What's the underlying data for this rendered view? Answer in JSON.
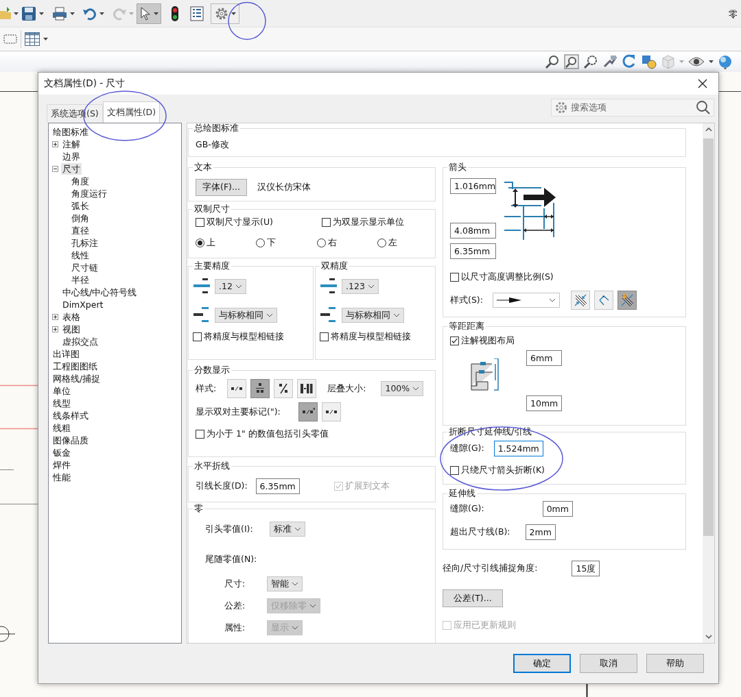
{
  "app": {
    "title_fragment": "零"
  },
  "dialog": {
    "title": "文档属性(D) - 尺寸"
  },
  "tabs": [
    {
      "label": "系统选项(S)",
      "selected": false
    },
    {
      "label": "文档属性(D)",
      "selected": true
    }
  ],
  "search": {
    "placeholder": "搜索选项"
  },
  "tree": [
    {
      "label": "绘图标准",
      "selected": false,
      "children": [
        {
          "label": "注解",
          "selected": false,
          "expanded": false
        },
        {
          "label": "边界",
          "selected": false
        },
        {
          "label": "尺寸",
          "selected": true,
          "expanded": true,
          "children": [
            {
              "label": "角度",
              "selected": false
            },
            {
              "label": "角度运行",
              "selected": false
            },
            {
              "label": "弧长",
              "selected": false
            },
            {
              "label": "倒角",
              "selected": false
            },
            {
              "label": "直径",
              "selected": false
            },
            {
              "label": "孔标注",
              "selected": false
            },
            {
              "label": "线性",
              "selected": false
            },
            {
              "label": "尺寸链",
              "selected": false
            },
            {
              "label": "半径",
              "selected": false
            }
          ]
        },
        {
          "label": "中心线/中心符号线",
          "selected": false
        },
        {
          "label": "DimXpert",
          "selected": false
        },
        {
          "label": "表格",
          "selected": false,
          "expanded": false
        },
        {
          "label": "视图",
          "selected": false,
          "expanded": false
        },
        {
          "label": "虚拟交点",
          "selected": false
        }
      ]
    },
    {
      "label": "出详图",
      "selected": false
    },
    {
      "label": "工程图图纸",
      "selected": false
    },
    {
      "label": "网格线/捕捉",
      "selected": false
    },
    {
      "label": "单位",
      "selected": false
    },
    {
      "label": "线型",
      "selected": false
    },
    {
      "label": "线条样式",
      "selected": false
    },
    {
      "label": "线粗",
      "selected": false
    },
    {
      "label": "图像品质",
      "selected": false
    },
    {
      "label": "钣金",
      "selected": false
    },
    {
      "label": "焊件",
      "selected": false
    },
    {
      "label": "性能",
      "selected": false
    }
  ],
  "general_standard": {
    "title": "总绘图标准",
    "value": "GB-修改"
  },
  "text_group": {
    "title": "文本",
    "button": "字体(F)...",
    "font": "汉仪长仿宋体"
  },
  "dual_dimensions": {
    "title": "双制尺寸",
    "checkboxes": [
      {
        "label": "双制尺寸显示(U)",
        "checked": false
      },
      {
        "label": "为双显示显示单位",
        "checked": false
      }
    ],
    "positions": [
      {
        "label": "上",
        "selected": true
      },
      {
        "label": "下",
        "selected": false
      },
      {
        "label": "右",
        "selected": false
      },
      {
        "label": "左",
        "selected": false
      }
    ]
  },
  "precision": [
    {
      "title": "主要精度",
      "value": ".12",
      "tolerance": "与标称相同",
      "link": {
        "label": "将精度与模型相链接",
        "checked": false
      }
    },
    {
      "title": "双精度",
      "value": ".123",
      "tolerance": "与标称相同",
      "link": {
        "label": "将精度与模型相链接",
        "checked": false
      }
    }
  ],
  "fraction": {
    "title": "分数显示",
    "style_label": "样式:",
    "styles": [
      {
        "kind": "slash",
        "selected": false
      },
      {
        "kind": "stacked",
        "selected": true
      },
      {
        "kind": "diagonal",
        "selected": false
      },
      {
        "kind": "dash",
        "selected": false
      }
    ],
    "stack_label": "层叠大小:",
    "stack_size": "100%",
    "dual_mark_label": "显示双对主要标记(\"):",
    "dual_marks": [
      {
        "kind": "inch",
        "selected": true
      },
      {
        "kind": "slash",
        "selected": false
      }
    ],
    "leading_zero": {
      "label": "为小于 1\" 的数值包括引头零值",
      "checked": false
    }
  },
  "jog": {
    "title": "水平折线",
    "label": "引线长度(D):",
    "value": "6.35mm",
    "extend": {
      "label": "扩展到文本",
      "checked": true,
      "disabled": true
    }
  },
  "zeros": {
    "title": "零",
    "leading_label": "引头零值(I):",
    "leading_value": "标准",
    "trailing_label": "尾随零值(N):",
    "trailing": [
      {
        "label": "尺寸:",
        "value": "智能",
        "disabled": false
      },
      {
        "label": "公差:",
        "value": "仅移除零",
        "disabled": true
      },
      {
        "label": "属性:",
        "value": "显示",
        "disabled": true
      }
    ]
  },
  "arrows": {
    "title": "箭头",
    "sizes": [
      "1.016mm",
      "4.08mm",
      "6.35mm"
    ],
    "scale": {
      "label": "以尺寸高度调整比例(S)",
      "checked": false
    },
    "style_label": "样式(S):",
    "placements": [
      {
        "kind": "inside",
        "selected": false
      },
      {
        "kind": "outside",
        "selected": false
      },
      {
        "kind": "smart",
        "selected": true
      }
    ]
  },
  "offset": {
    "title": "等距距离",
    "checkbox": {
      "label": "注解视图布局",
      "checked": true
    },
    "values": [
      "6mm",
      "10mm"
    ]
  },
  "break": {
    "title": "折断尺寸延伸线/引线",
    "label": "缝隙(G):",
    "value": "1.524mm",
    "focused": true,
    "checkbox": {
      "label": "只绕尺寸箭头折断(K)",
      "checked": false
    }
  },
  "extension": {
    "title": "延伸线",
    "rows": [
      {
        "label": "缝隙(G):",
        "value": "0mm"
      },
      {
        "label": "超出尺寸线(B):",
        "value": "2mm"
      }
    ]
  },
  "snap": {
    "label": "径向/尺寸引线捕捉角度:",
    "value": "15度"
  },
  "tolerance_button": "公差(T)...",
  "apply_rules": {
    "label": "应用已更新规则",
    "checked": false,
    "disabled": true
  },
  "buttons": [
    {
      "label": "确定",
      "default": true
    },
    {
      "label": "取消",
      "default": false
    },
    {
      "label": "帮助",
      "default": false
    }
  ]
}
